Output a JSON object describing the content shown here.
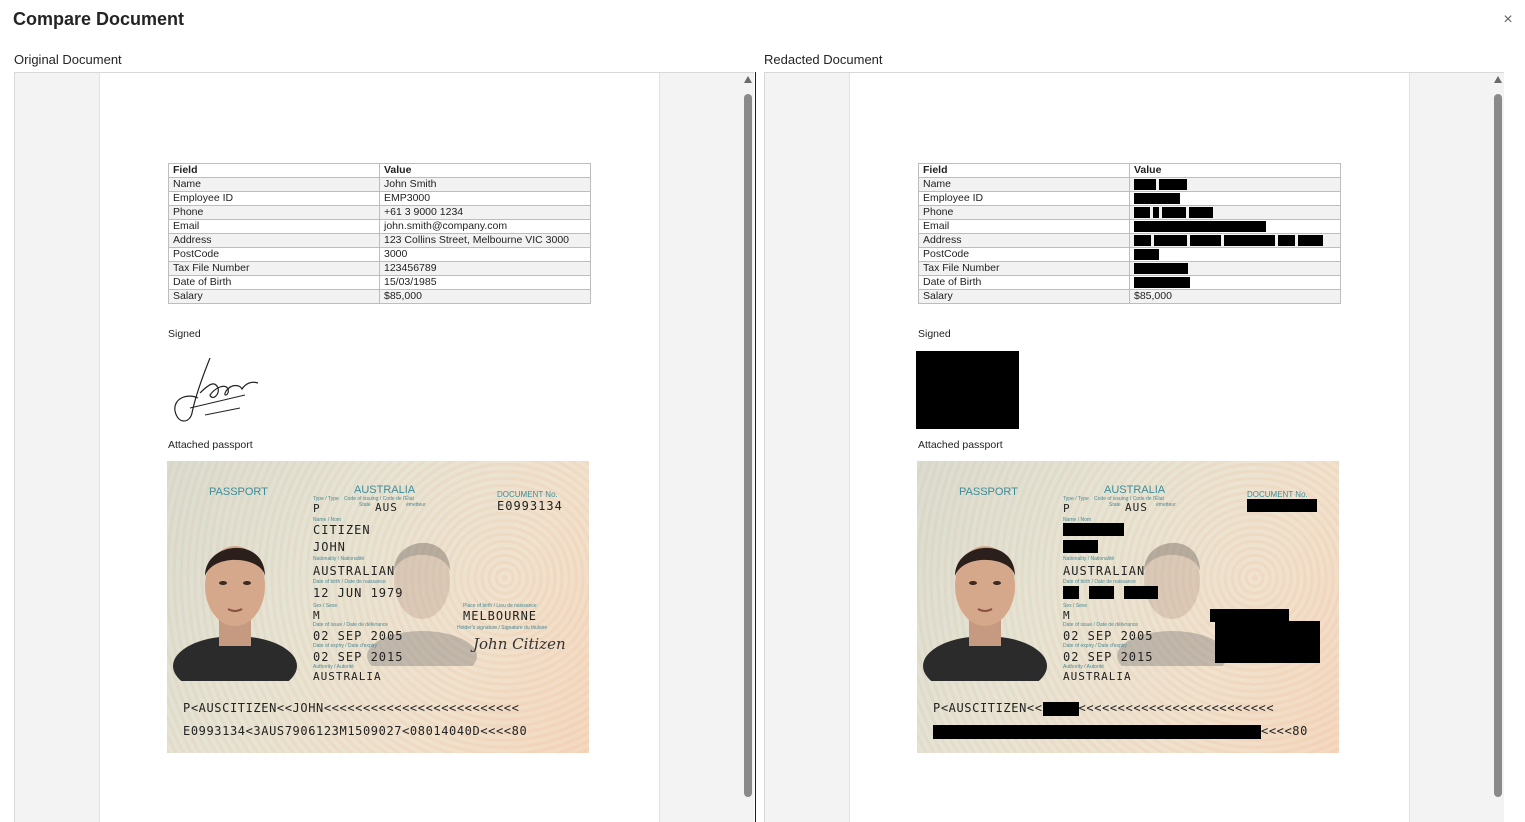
{
  "dialog": {
    "title": "Compare Document",
    "close_glyph": "×"
  },
  "panes": {
    "original_label": "Original Document",
    "redacted_label": "Redacted Document"
  },
  "table": {
    "headers": [
      "Field",
      "Value"
    ],
    "rows": [
      {
        "field": "Name",
        "value": "John Smith",
        "redacted": true
      },
      {
        "field": "Employee ID",
        "value": "EMP3000",
        "redacted": true
      },
      {
        "field": "Phone",
        "value": "+61 3 9000 1234",
        "redacted": true
      },
      {
        "field": "Email",
        "value": "john.smith@company.com",
        "redacted": true
      },
      {
        "field": "Address",
        "value": "123 Collins Street, Melbourne VIC 3000",
        "redacted": true
      },
      {
        "field": "PostCode",
        "value": "3000",
        "redacted": true
      },
      {
        "field": "Tax File Number",
        "value": "123456789",
        "redacted": true
      },
      {
        "field": "Date of Birth",
        "value": "15/03/1985",
        "redacted": true
      },
      {
        "field": "Salary",
        "value": "$85,000",
        "redacted": false
      }
    ]
  },
  "signed_label": "Signed",
  "attached_label": "Attached passport",
  "passport": {
    "heading": "PASSPORT",
    "country": "AUSTRALIA",
    "type_label": "Type / Type",
    "code_label": "Code of issuing / Code de l'État",
    "state_label": "State",
    "emetteur": "émetteur",
    "type": "P",
    "code": "AUS",
    "doc_no_label": "DOCUMENT No.",
    "doc_no": "E0993134",
    "name_label": "Name / Nom",
    "surname": "CITIZEN",
    "given": "JOHN",
    "nationality_label": "Nationality / Nationalité",
    "nationality": "AUSTRALIAN",
    "dob_label": "Date of birth / Date de naissance",
    "dob": "12 JUN 1979",
    "sex_label": "Sex / Sexe",
    "sex": "M",
    "pob_label": "Place of birth / Lieu de naissance",
    "pob": "MELBOURNE",
    "issue_label": "Date of issue / Date de délivrance",
    "issue": "02 SEP 2005",
    "holder_sig_label": "Holder's signature / Signature du titulaire",
    "expiry_label": "Date of expiry / Date d'expiry",
    "expiry": "02 SEP 2015",
    "authority_label": "Authority / Autorité",
    "authority": "AUSTRALIA",
    "holder_signature": "John Citizen",
    "mrz1": "P<AUSCITIZEN<<JOHN<<<<<<<<<<<<<<<<<<<<<<<<<",
    "mrz2": "E0993134<3AUS7906123M1509027<08014040D<<<<80",
    "mrz1_redacted_prefix": "P<AUSCITIZEN<<",
    "mrz1_redacted_suffix": "<<<<<<<<<<<<<<<<<<<<<<<<<",
    "mrz2_redacted_suffix": "<<<<80"
  }
}
